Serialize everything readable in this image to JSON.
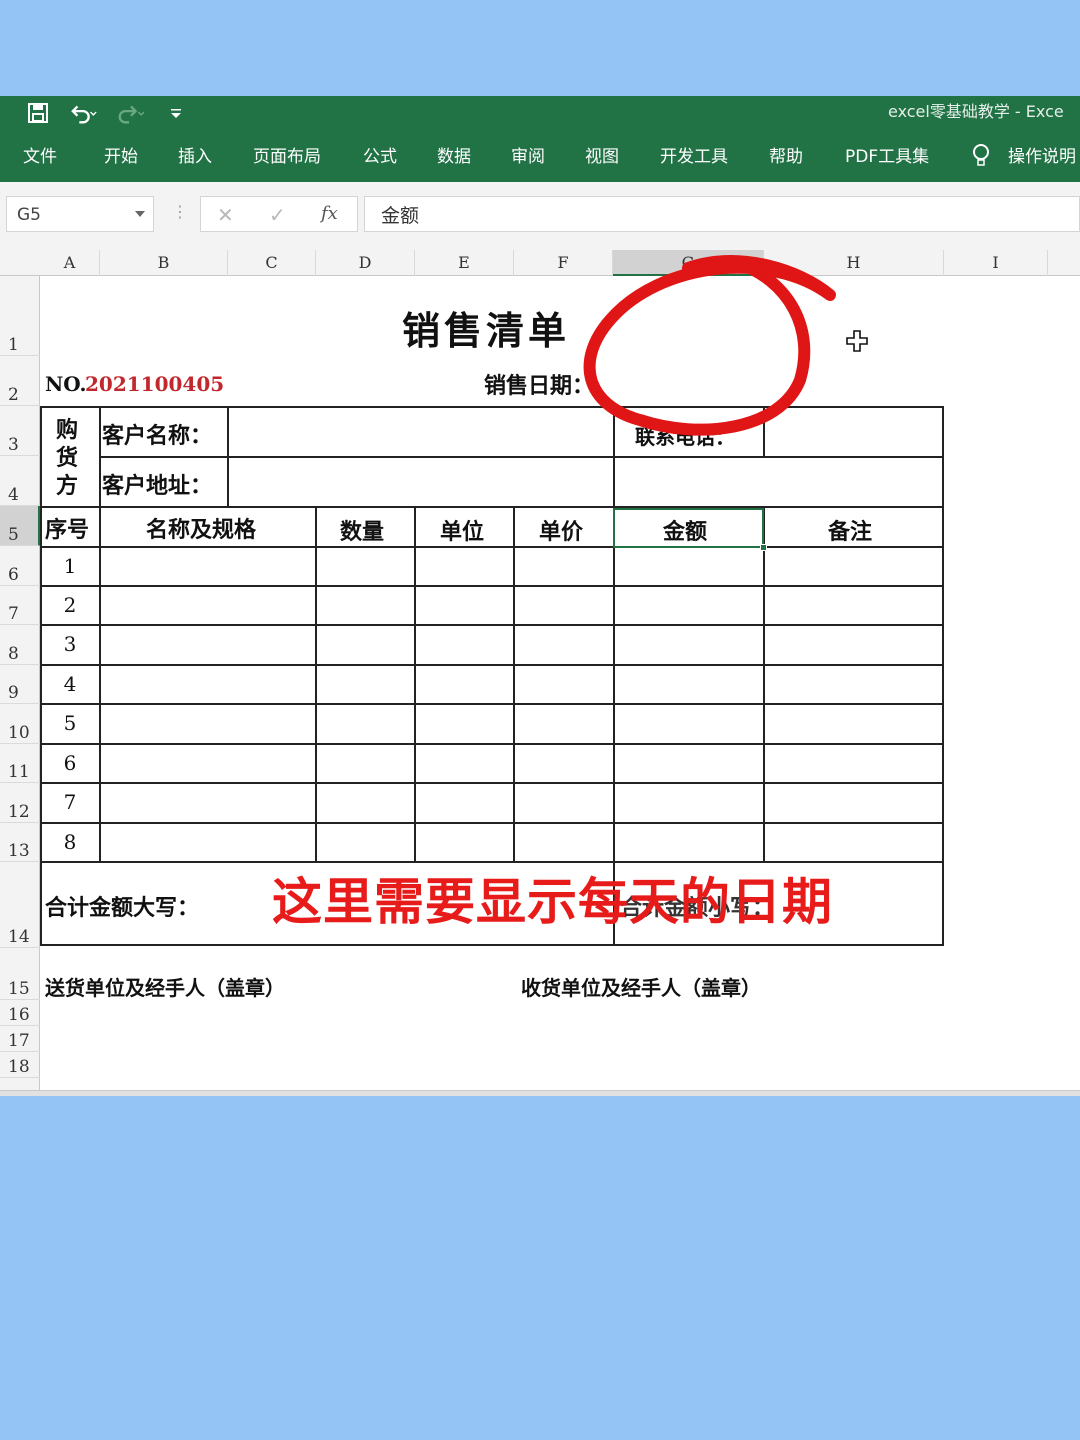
{
  "window": {
    "doc_title": "excel零基础教学  -  Exce"
  },
  "ribbon": {
    "tabs": [
      "文件",
      "开始",
      "插入",
      "页面布局",
      "公式",
      "数据",
      "审阅",
      "视图",
      "开发工具",
      "帮助",
      "PDF工具集",
      "操作说明"
    ]
  },
  "formula_bar": {
    "name_box": "G5",
    "cancel_glyph": "✕",
    "enter_glyph": "✓",
    "fx_glyph": "fx",
    "content": "金额"
  },
  "columns": [
    "A",
    "B",
    "C",
    "D",
    "E",
    "F",
    "G",
    "H",
    "I"
  ],
  "rows": [
    "1",
    "2",
    "3",
    "4",
    "5",
    "6",
    "7",
    "8",
    "9",
    "10",
    "11",
    "12",
    "13",
    "14",
    "15",
    "16",
    "17",
    "18"
  ],
  "sheet": {
    "title": "销售清单",
    "no_label": "NO.",
    "no_value": "2021100405",
    "sale_date_label": "销售日期：",
    "buyer_label": [
      "购",
      "货",
      "方"
    ],
    "customer_name_label": "客户名称：",
    "contact_phone_label": "联系电话：",
    "customer_address_label": "客户地址：",
    "table_headers": [
      "序号",
      "名称及规格",
      "数量",
      "单位",
      "单价",
      "金额",
      "备注"
    ],
    "serials": [
      "1",
      "2",
      "3",
      "4",
      "5",
      "6",
      "7",
      "8"
    ],
    "total_uppercase_label": "合计金额大写：",
    "total_lowercase_label": "合计金额小写：",
    "sender_label": "送货单位及经手人（盖章）",
    "receiver_label": "收货单位及经手人（盖章）"
  },
  "overlay": {
    "caption": "这里需要显示每天的日期",
    "caption_color": "#e81b1b"
  },
  "colors": {
    "ribbon": "#217346",
    "background": "#94c3f5",
    "no_value": "#c0282d"
  }
}
